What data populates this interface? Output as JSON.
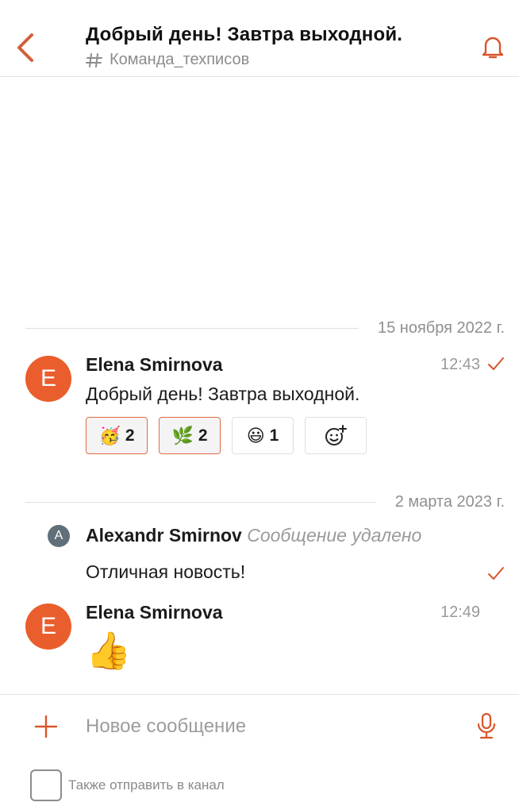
{
  "header": {
    "title": "Добрый день! Завтра выходной.",
    "channel": "Команда_техписов",
    "back_icon": "chevron-left-icon",
    "bell_icon": "bell-icon",
    "channel_icon": "hash-channel-icon"
  },
  "messages": {
    "date1": "15 ноября 2022 г.",
    "date2": "2 марта 2023 г.",
    "m1": {
      "avatar": "E",
      "author": "Elena Smirnova",
      "time": "12:43",
      "text": "Добрый день! Завтра выходной."
    },
    "reactions": [
      {
        "emoji": "🥳",
        "count": "2",
        "active": true
      },
      {
        "emoji": "🌿",
        "count": "2",
        "active": true
      },
      {
        "emoji": "😃",
        "count": "1",
        "active": false
      }
    ],
    "add_reaction_icon": "add-reaction-icon",
    "m2": {
      "avatar": "A",
      "author": "Alexandr Smirnov",
      "deleted": "Сообщение удалено",
      "text": "Отличная новость!"
    },
    "m3": {
      "avatar": "E",
      "author": "Elena Smirnova",
      "time": "12:49",
      "emoji": "👍"
    }
  },
  "composer": {
    "placeholder": "Новое сообщение",
    "plus_icon": "plus-icon",
    "mic_icon": "microphone-icon",
    "also_send_label": "Также отправить в канал"
  },
  "colors": {
    "accent": "#ea5d2c",
    "text": "#1b1b1b",
    "muted": "#9a9a9a",
    "divider": "#e4e4e4"
  }
}
